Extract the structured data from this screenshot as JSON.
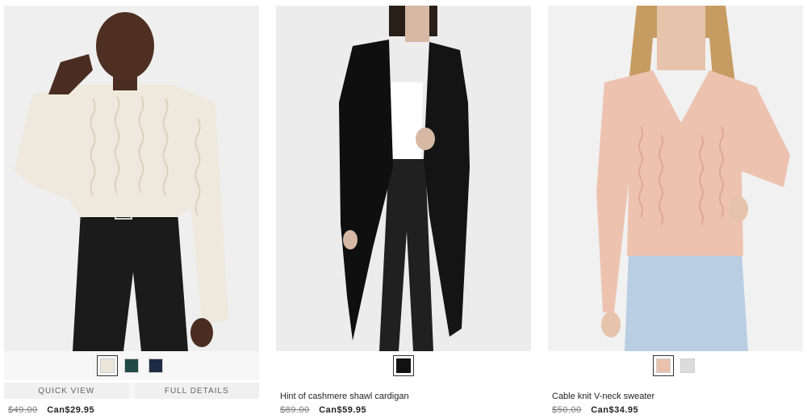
{
  "products": [
    {
      "name": "",
      "price_old": "$49.00",
      "price_new": "Can$29.95",
      "swatches": [
        {
          "color": "#ece6da",
          "selected": true
        },
        {
          "color": "#1f4a48",
          "selected": false
        },
        {
          "color": "#1f2a44",
          "selected": false
        }
      ],
      "quick_view_label": "QUICK VIEW",
      "full_details_label": "FULL DETAILS"
    },
    {
      "name": "Hint of cashmere shawl cardigan",
      "price_old": "$89.00",
      "price_new": "Can$59.95",
      "swatches": [
        {
          "color": "#111111",
          "selected": true
        }
      ]
    },
    {
      "name": "Cable knit V-neck sweater",
      "price_old": "$50.00",
      "price_new": "Can$34.95",
      "swatches": [
        {
          "color": "#e9c2ae",
          "selected": true
        },
        {
          "color": "#dcdcdc",
          "selected": false
        }
      ]
    }
  ]
}
